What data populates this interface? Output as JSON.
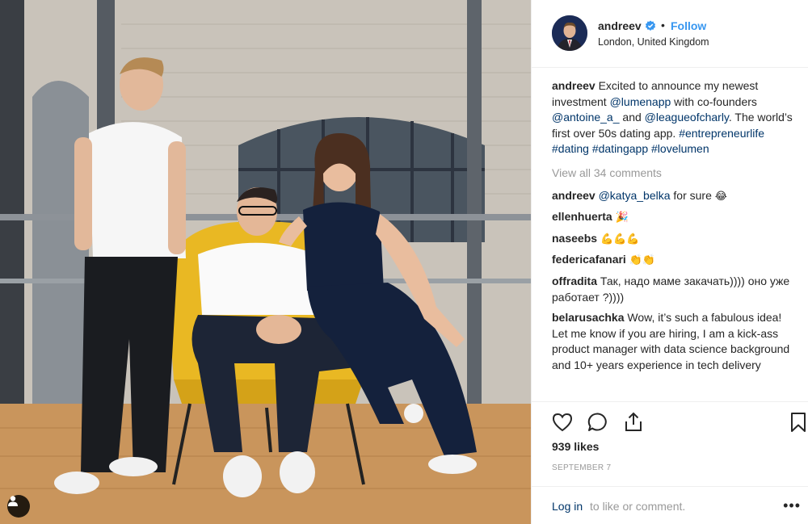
{
  "post": {
    "author": {
      "username": "andreev",
      "location": "London, United Kingdom",
      "follow_label": "Follow",
      "separator": "•",
      "verified_icon": "verified-badge-icon"
    },
    "caption": {
      "username": "andreev",
      "parts": {
        "p1": " Excited to announce my newest investment ",
        "m1": "@lumenapp",
        "p2": " with co-founders ",
        "m2": "@antoine_a_",
        "p3": " and ",
        "m3": "@leagueofcharly",
        "p4": ". The world’s first over 50s dating app. ",
        "t1": "#entrepreneurlife",
        "t2": "#dating",
        "t3": "#datingapp",
        "t4": "#lovelumen"
      }
    },
    "view_all_comments": "View all 34 comments",
    "comments": [
      {
        "username": "andreev",
        "mention": "@katya_belka",
        "text": " for sure ",
        "emoji": "😂"
      },
      {
        "username": "ellenhuerta",
        "text": "",
        "emoji": "🎉"
      },
      {
        "username": "naseebs",
        "text": "",
        "emoji": "💪💪💪"
      },
      {
        "username": "federicafanari",
        "text": "",
        "emoji": "👏👏"
      },
      {
        "username": "offradita",
        "text": "Так, надо маме закачать)))) оно уже работает ?))))",
        "emoji": ""
      },
      {
        "username": "belarusachka",
        "text": "Wow, it’s such a fabulous idea! Let me know if you are hiring, I am a kick-ass product manager with data science background and 10+ years experience in tech delivery",
        "emoji": ""
      }
    ],
    "actions": {
      "like_icon": "heart-icon",
      "comment_icon": "comment-bubble-icon",
      "share_icon": "share-icon",
      "save_icon": "bookmark-icon"
    },
    "likes": "939 likes",
    "date": "September 7",
    "footer": {
      "login_label": "Log in",
      "login_rest": " to like or comment.",
      "more_label": "•••"
    },
    "photo_tag_icon": "user-tag-icon",
    "colors": {
      "link_blue": "#3897f0",
      "mention_blue": "#003569",
      "muted": "#999999",
      "text": "#262626",
      "border": "#efefef",
      "chair_yellow": "#e9b823"
    }
  }
}
